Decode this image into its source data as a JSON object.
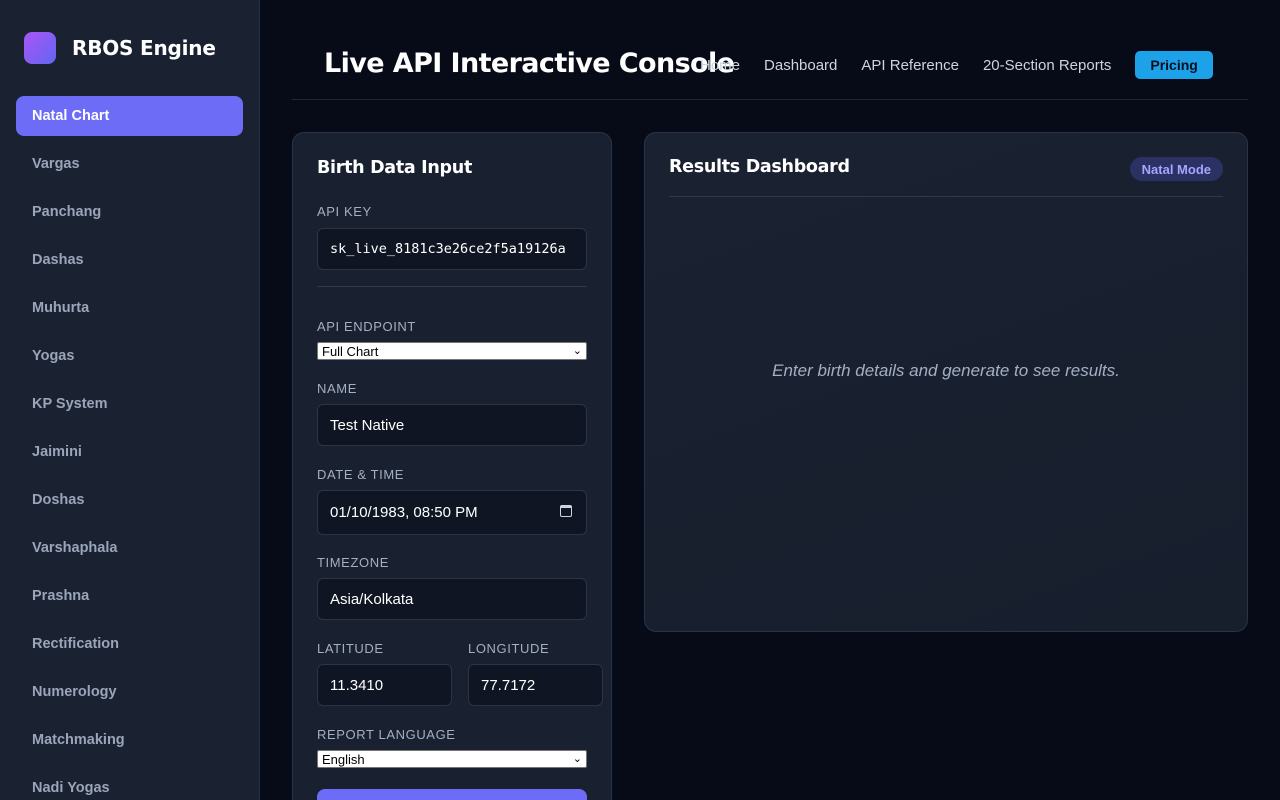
{
  "brand": {
    "name": "RBOS Engine"
  },
  "sidebar": {
    "items": [
      {
        "label": "Natal Chart",
        "active": true
      },
      {
        "label": "Vargas",
        "active": false
      },
      {
        "label": "Panchang",
        "active": false
      },
      {
        "label": "Dashas",
        "active": false
      },
      {
        "label": "Muhurta",
        "active": false
      },
      {
        "label": "Yogas",
        "active": false
      },
      {
        "label": "KP System",
        "active": false
      },
      {
        "label": "Jaimini",
        "active": false
      },
      {
        "label": "Doshas",
        "active": false
      },
      {
        "label": "Varshaphala",
        "active": false
      },
      {
        "label": "Prashna",
        "active": false
      },
      {
        "label": "Rectification",
        "active": false
      },
      {
        "label": "Numerology",
        "active": false
      },
      {
        "label": "Matchmaking",
        "active": false
      },
      {
        "label": "Nadi Yogas",
        "active": false
      }
    ]
  },
  "header": {
    "title": "Live API Interactive Console",
    "nav": [
      "Home",
      "Dashboard",
      "API Reference",
      "20-Section Reports"
    ],
    "pricing_label": "Pricing"
  },
  "form": {
    "title": "Birth Data Input",
    "api_key_label": "API KEY",
    "api_key_value": "sk_live_8181c3e26ce2f5a19126a",
    "endpoint_label": "API ENDPOINT",
    "endpoint_value": "Full Chart",
    "name_label": "NAME",
    "name_value": "Test Native",
    "datetime_label": "DATE & TIME",
    "datetime_value": "01/10/1983, 08:50 PM",
    "timezone_label": "TIMEZONE",
    "timezone_value": "Asia/Kolkata",
    "latitude_label": "LATITUDE",
    "latitude_value": "11.3410",
    "longitude_label": "LONGITUDE",
    "longitude_value": "77.7172",
    "language_label": "REPORT LANGUAGE",
    "language_value": "English"
  },
  "results": {
    "title": "Results Dashboard",
    "badge": "Natal Mode",
    "placeholder": "Enter birth details and generate to see results."
  },
  "colors": {
    "accent": "#6d6cf7",
    "pricing": "#1da1e8",
    "background": "#070b18",
    "card": "#192130"
  }
}
